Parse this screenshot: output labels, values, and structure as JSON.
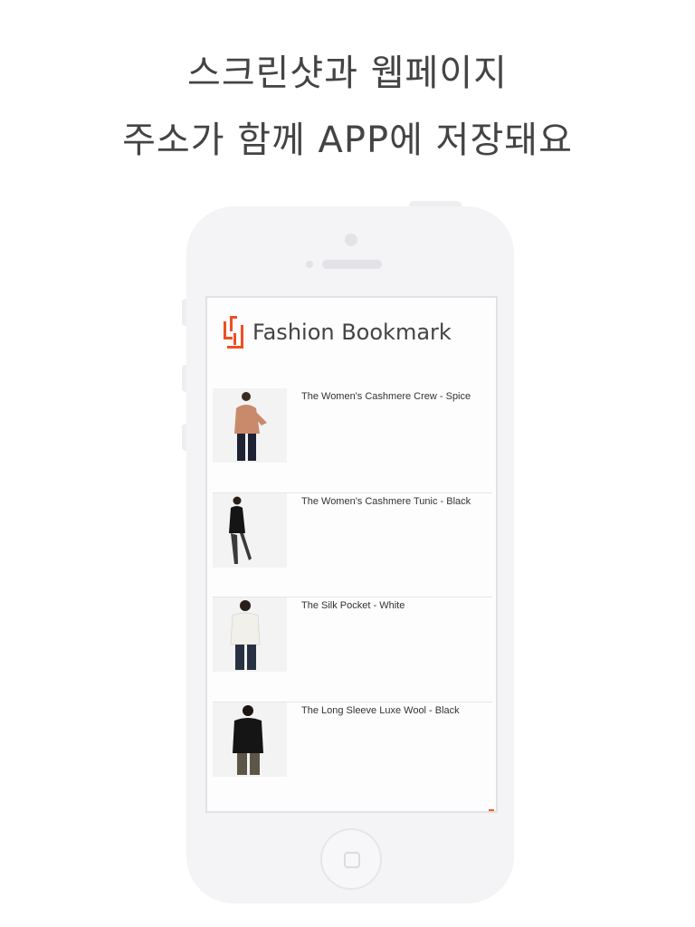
{
  "headline": {
    "line1": "스크린샷과 웹페이지",
    "line2": "주소가 함께 APP에 저장돼요"
  },
  "app": {
    "title": "Fashion Bookmark",
    "brand_color": "#f04e23"
  },
  "bookmarks": [
    {
      "title": "The Women's Cashmere Crew - Spice",
      "top_color": "#c98a6b",
      "bottom_color": "#1f2233"
    },
    {
      "title": "The Women's Cashmere Tunic - Black",
      "top_color": "#151515",
      "bottom_color": "#2a2a2a"
    },
    {
      "title": "The Silk Pocket - White",
      "top_color": "#f2f0ea",
      "bottom_color": "#273142"
    },
    {
      "title": "The Long Sleeve Luxe Wool - Black",
      "top_color": "#151515",
      "bottom_color": "#5d5648"
    }
  ]
}
